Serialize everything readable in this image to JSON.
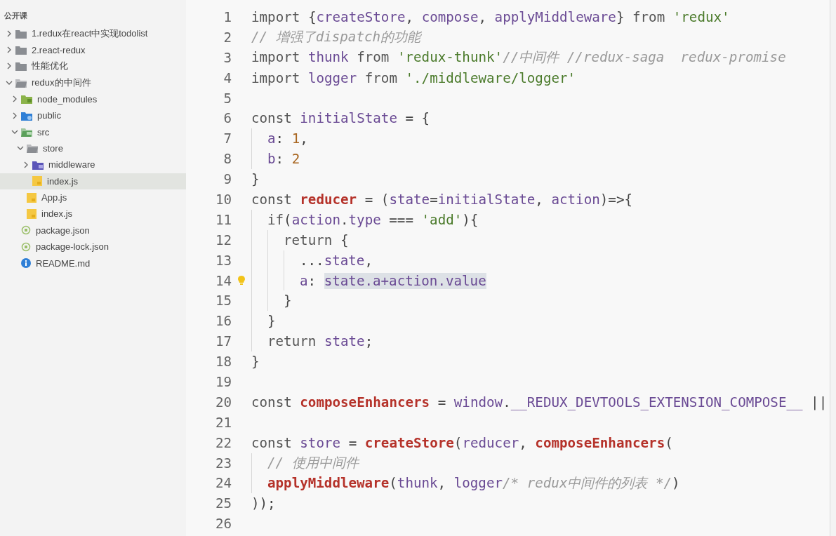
{
  "explorer": {
    "section": "公开课",
    "tree": [
      {
        "label": "1.redux在react中实现todolist",
        "kind": "folder",
        "expanded": false,
        "selected": false
      },
      {
        "label": "2.react-redux",
        "kind": "folder",
        "expanded": false,
        "selected": false
      },
      {
        "label": "性能优化",
        "kind": "folder",
        "expanded": false,
        "selected": false
      },
      {
        "label": "redux的中间件",
        "kind": "folder",
        "expanded": true,
        "selected": false,
        "children": [
          {
            "label": "node_modules",
            "kind": "node-folder",
            "expanded": false,
            "selected": false
          },
          {
            "label": "public",
            "kind": "public-folder",
            "expanded": false,
            "selected": false
          },
          {
            "label": "src",
            "kind": "src-folder",
            "expanded": true,
            "selected": false,
            "children": [
              {
                "label": "store",
                "kind": "folder",
                "expanded": true,
                "selected": false,
                "children": [
                  {
                    "label": "middleware",
                    "kind": "middleware-folder",
                    "expanded": false,
                    "selected": false
                  },
                  {
                    "label": "index.js",
                    "kind": "js",
                    "selected": true
                  }
                ]
              },
              {
                "label": "App.js",
                "kind": "js",
                "selected": false
              },
              {
                "label": "index.js",
                "kind": "js",
                "selected": false
              }
            ]
          },
          {
            "label": "package.json",
            "kind": "json",
            "selected": false
          },
          {
            "label": "package-lock.json",
            "kind": "json",
            "selected": false
          },
          {
            "label": "README.md",
            "kind": "readme",
            "selected": false
          }
        ]
      }
    ]
  },
  "editor": {
    "lines": [
      {
        "number": "1",
        "tokens": [
          {
            "text": "import ",
            "kind": "keyword"
          },
          {
            "text": "{",
            "kind": "punct"
          },
          {
            "text": "createStore",
            "kind": "ident"
          },
          {
            "text": ", ",
            "kind": "punct"
          },
          {
            "text": "compose",
            "kind": "ident"
          },
          {
            "text": ", ",
            "kind": "punct"
          },
          {
            "text": "applyMiddleware",
            "kind": "ident"
          },
          {
            "text": "} ",
            "kind": "punct"
          },
          {
            "text": "from ",
            "kind": "keyword"
          },
          {
            "text": "'redux'",
            "kind": "string"
          }
        ]
      },
      {
        "number": "2",
        "tokens": [
          {
            "text": "// 增强了dispatch的功能",
            "kind": "comment"
          }
        ]
      },
      {
        "number": "3",
        "tokens": [
          {
            "text": "import ",
            "kind": "keyword"
          },
          {
            "text": "thunk ",
            "kind": "ident"
          },
          {
            "text": "from ",
            "kind": "keyword"
          },
          {
            "text": "'redux-thunk'",
            "kind": "string"
          },
          {
            "text": "//中间件 //redux-saga  redux-promise",
            "kind": "comment"
          }
        ]
      },
      {
        "number": "4",
        "tokens": [
          {
            "text": "import ",
            "kind": "keyword"
          },
          {
            "text": "logger ",
            "kind": "ident"
          },
          {
            "text": "from ",
            "kind": "keyword"
          },
          {
            "text": "'./middleware/logger'",
            "kind": "string"
          }
        ]
      },
      {
        "number": "5"
      },
      {
        "number": "6",
        "tokens": [
          {
            "text": "const ",
            "kind": "keyword"
          },
          {
            "text": "initialState",
            "kind": "ident"
          },
          {
            "text": " = {",
            "kind": "punct"
          }
        ],
        "children": [
          {
            "number": "7",
            "tokens": [
              {
                "text": "a",
                "kind": "ident"
              },
              {
                "text": ": ",
                "kind": "punct"
              },
              {
                "text": "1",
                "kind": "number"
              },
              {
                "text": ",",
                "kind": "punct"
              }
            ]
          },
          {
            "number": "8",
            "tokens": [
              {
                "text": "b",
                "kind": "ident"
              },
              {
                "text": ": ",
                "kind": "punct"
              },
              {
                "text": "2",
                "kind": "number"
              }
            ]
          }
        ]
      },
      {
        "number": "9",
        "tokens": [
          {
            "text": "}",
            "kind": "punct"
          }
        ]
      },
      {
        "number": "10",
        "tokens": [
          {
            "text": "const ",
            "kind": "keyword"
          },
          {
            "text": "reducer",
            "kind": "definition"
          },
          {
            "text": " = (",
            "kind": "punct"
          },
          {
            "text": "state",
            "kind": "ident"
          },
          {
            "text": "=",
            "kind": "punct"
          },
          {
            "text": "initialState",
            "kind": "ident"
          },
          {
            "text": ", ",
            "kind": "punct"
          },
          {
            "text": "action",
            "kind": "ident"
          },
          {
            "text": ")=>{",
            "kind": "punct"
          }
        ],
        "children": [
          {
            "number": "11",
            "tokens": [
              {
                "text": "if",
                "kind": "keyword"
              },
              {
                "text": "(",
                "kind": "punct"
              },
              {
                "text": "action",
                "kind": "ident"
              },
              {
                "text": ".",
                "kind": "punct"
              },
              {
                "text": "type",
                "kind": "ident"
              },
              {
                "text": " === ",
                "kind": "punct"
              },
              {
                "text": "'add'",
                "kind": "string"
              },
              {
                "text": "){",
                "kind": "punct"
              }
            ],
            "children": [
              {
                "number": "12",
                "tokens": [
                  {
                    "text": "return ",
                    "kind": "keyword"
                  },
                  {
                    "text": "{",
                    "kind": "punct"
                  }
                ],
                "children": [
                  {
                    "number": "13",
                    "tokens": [
                      {
                        "text": "...",
                        "kind": "punct"
                      },
                      {
                        "text": "state",
                        "kind": "ident"
                      },
                      {
                        "text": ",",
                        "kind": "punct"
                      }
                    ]
                  },
                  {
                    "number": "14",
                    "lightbulb": true,
                    "tokens": [
                      {
                        "text": "a",
                        "kind": "ident"
                      },
                      {
                        "text": ": ",
                        "kind": "punct"
                      },
                      {
                        "text": "state.a+action.value",
                        "kind": "selection"
                      }
                    ]
                  }
                ]
              },
              {
                "number": "15",
                "tokens": [
                  {
                    "text": "}",
                    "kind": "punct"
                  }
                ]
              }
            ]
          },
          {
            "number": "16",
            "tokens": [
              {
                "text": "}",
                "kind": "punct"
              }
            ]
          },
          {
            "number": "17",
            "tokens": [
              {
                "text": "return ",
                "kind": "keyword"
              },
              {
                "text": "state",
                "kind": "ident"
              },
              {
                "text": ";",
                "kind": "punct"
              }
            ]
          }
        ]
      },
      {
        "number": "18",
        "tokens": [
          {
            "text": "}",
            "kind": "punct"
          }
        ]
      },
      {
        "number": "19"
      },
      {
        "number": "20",
        "tokens": [
          {
            "text": "const ",
            "kind": "keyword"
          },
          {
            "text": "composeEnhancers",
            "kind": "definition"
          },
          {
            "text": " = ",
            "kind": "punct"
          },
          {
            "text": "window",
            "kind": "ident"
          },
          {
            "text": ".",
            "kind": "punct"
          },
          {
            "text": "__REDUX_DEVTOOLS_EXTENSION_COMPOSE__",
            "kind": "ident"
          },
          {
            "text": " ||",
            "kind": "punct"
          }
        ]
      },
      {
        "number": "21"
      },
      {
        "number": "22",
        "tokens": [
          {
            "text": "const ",
            "kind": "keyword"
          },
          {
            "text": "store",
            "kind": "ident"
          },
          {
            "text": " = ",
            "kind": "punct"
          },
          {
            "text": "createStore",
            "kind": "definition"
          },
          {
            "text": "(",
            "kind": "punct"
          },
          {
            "text": "reducer",
            "kind": "ident"
          },
          {
            "text": ", ",
            "kind": "punct"
          },
          {
            "text": "composeEnhancers",
            "kind": "definition"
          },
          {
            "text": "(",
            "kind": "punct"
          }
        ],
        "children": [
          {
            "number": "23",
            "tokens": [
              {
                "text": "// 使用中间件",
                "kind": "comment"
              }
            ]
          },
          {
            "number": "24",
            "tokens": [
              {
                "text": "applyMiddleware",
                "kind": "definition"
              },
              {
                "text": "(",
                "kind": "punct"
              },
              {
                "text": "thunk",
                "kind": "ident"
              },
              {
                "text": ", ",
                "kind": "punct"
              },
              {
                "text": "logger",
                "kind": "ident"
              },
              {
                "text": "/* redux中间件的列表 */",
                "kind": "comment"
              },
              {
                "text": ")",
                "kind": "punct"
              }
            ]
          }
        ]
      },
      {
        "number": "25",
        "tokens": [
          {
            "text": "));",
            "kind": "punct"
          }
        ]
      },
      {
        "number": "26"
      }
    ]
  }
}
